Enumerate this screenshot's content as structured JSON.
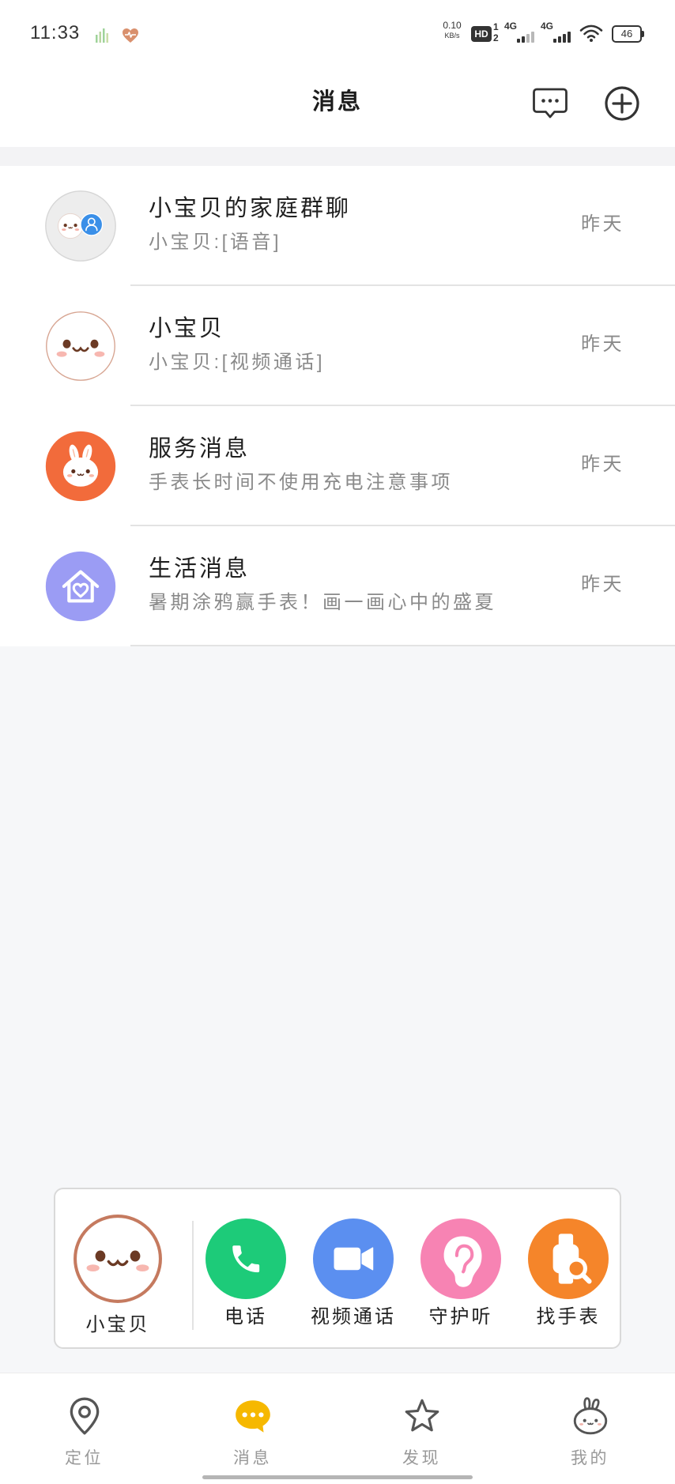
{
  "status_bar": {
    "time": "11:33",
    "net_speed_value": "0.10",
    "net_speed_unit": "KB/s",
    "hd_label": "HD",
    "sim1": "1",
    "sim2": "2",
    "network1": "4G",
    "network2": "4G",
    "battery": "46",
    "icons": [
      "activity-bars-icon",
      "heart-icon",
      "wifi-icon",
      "battery-icon"
    ]
  },
  "header": {
    "title": "消息",
    "actions": [
      "chat-bubble-icon",
      "add-circle-icon"
    ]
  },
  "conversations": [
    {
      "title": "小宝贝的家庭群聊",
      "preview": "小宝贝:[语音]",
      "time": "昨天",
      "avatar": "family-group-avatar"
    },
    {
      "title": "小宝贝",
      "preview": "小宝贝:[视频通话]",
      "time": "昨天",
      "avatar": "baby-face-avatar"
    },
    {
      "title": "服务消息",
      "preview": "手表长时间不使用充电注意事项",
      "time": "昨天",
      "avatar": "bunny-avatar",
      "avatar_color": "#f26b3b"
    },
    {
      "title": "生活消息",
      "preview": "暑期涂鸦赢手表！画一画心中的盛夏",
      "time": "昨天",
      "avatar": "house-heart-avatar",
      "avatar_color": "#9b9cf4"
    }
  ],
  "quick_actions": {
    "contact_name": "小宝贝",
    "actions": [
      {
        "label": "电话",
        "icon": "phone-icon",
        "color": "#1dcb79"
      },
      {
        "label": "视频通话",
        "icon": "video-camera-icon",
        "color": "#5b8ff0"
      },
      {
        "label": "守护听",
        "icon": "ear-icon",
        "color": "#f783b3"
      },
      {
        "label": "找手表",
        "icon": "find-watch-icon",
        "color": "#f5852a"
      }
    ]
  },
  "bottom_nav": {
    "items": [
      {
        "label": "定位",
        "icon": "location-pin-icon",
        "active": false
      },
      {
        "label": "消息",
        "icon": "chat-bubble-icon",
        "active": true
      },
      {
        "label": "发现",
        "icon": "star-icon",
        "active": false
      },
      {
        "label": "我的",
        "icon": "bunny-icon",
        "active": false
      }
    ]
  },
  "colors": {
    "nav_active": "#f6b800",
    "nav_inactive": "#555555",
    "background": "#f6f7f9"
  }
}
